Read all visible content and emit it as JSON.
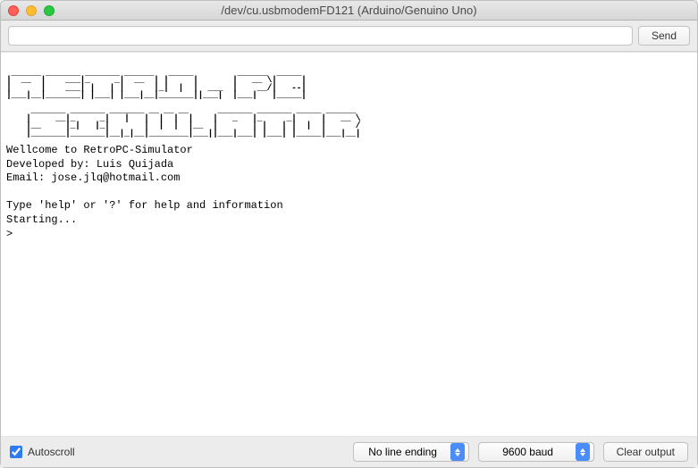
{
  "window": {
    "title": "/dev/cu.usbmodemFD121 (Arduino/Genuino Uno)"
  },
  "toolbar": {
    "input_value": "",
    "send_label": "Send"
  },
  "console": {
    "banner": " ______ _______ _______ ______   _____         ______  _____ \n|  __  |    ___|_     _|  __  | |     |       |   __ \\|     |\n|      |    ___| |   | |      |_|  |  |  ___  |    __/|   --|\n|___|__|_______| |___| |___|__|_______||___|  |___|   |_____|\n                                                              \n     _______ _______ _______ __ __ __      _______ _______ _____ ______ \n    |     __|_     _|   |   |  |  |  |    |   _   |_     _|     |   __ \\\n    |__     |_|   |_|       |  |  |  |__  |       | |   | |  |  |      /\n    |_______|_______|__|_|__|________|___||___|___| |___| |_____|___|__|",
    "line_welcome": "Wellcome to RetroPC-Simulator",
    "line_developed": "Developed by: Luis Quijada",
    "line_email": "Email: jose.jlq@hotmail.com",
    "line_help": "Type 'help' or '?' for help and information",
    "line_starting": "Starting...",
    "prompt": ">"
  },
  "statusbar": {
    "autoscroll_label": "Autoscroll",
    "autoscroll_checked": true,
    "line_ending": "No line ending",
    "baud_rate": "9600 baud",
    "clear_label": "Clear output"
  }
}
